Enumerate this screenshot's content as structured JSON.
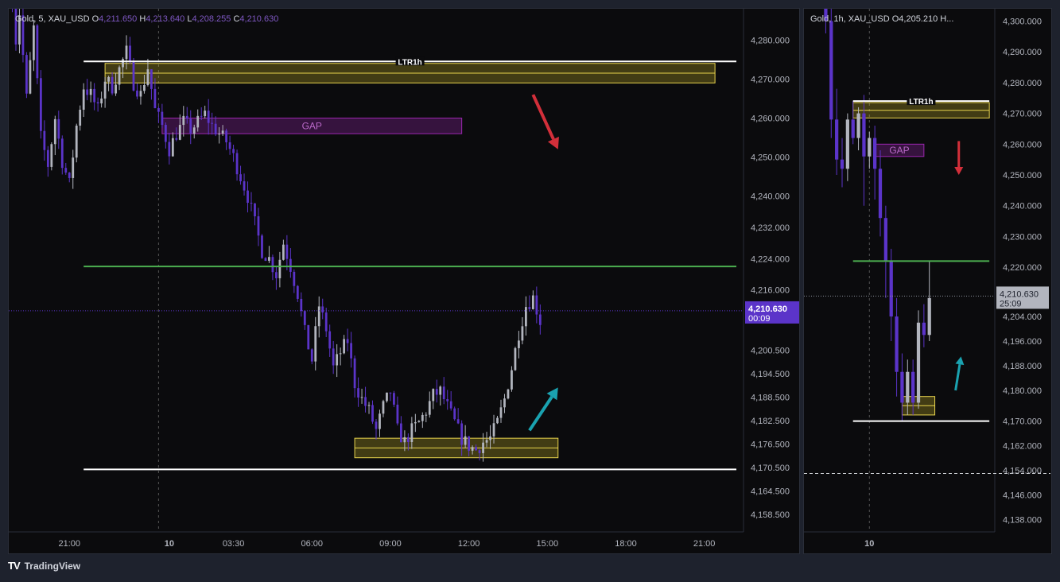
{
  "app": {
    "brand": "TradingView",
    "brand_logo": "TV"
  },
  "colors": {
    "bull": "#b2b5be",
    "bear": "#5b34c9",
    "last_price_bg": "#5b34c9",
    "green_line": "#4caf50",
    "white_line": "#ffffff",
    "zone_fill": "rgba(212,190,40,0.28)",
    "zone_stroke": "#e8d44d",
    "gap_fill": "rgba(155,39,176,0.30)",
    "gap_stroke": "#9c27b0",
    "gap_text": "#ba68c8",
    "arrow_red": "#d32f3a",
    "arrow_teal": "#1aa2b0"
  },
  "chart_data": [
    {
      "type": "candlestick",
      "legend": {
        "symbol": "Gold, 5, XAU_USD",
        "o_label": "O",
        "o_value": "4,211.650",
        "h_label": "H",
        "h_value": "4,213.640",
        "l_label": "L",
        "l_value": "4,208.255",
        "c_label": "C",
        "c_value": "4,210.630"
      },
      "y_ticks": [
        "4,280.000",
        "4,270.000",
        "4,260.000",
        "4,250.000",
        "4,240.000",
        "4,232.000",
        "4,224.000",
        "4,216.000",
        "4,200.500",
        "4,194.500",
        "4,188.500",
        "4,182.500",
        "4,176.500",
        "4,170.500",
        "4,164.500",
        "4,158.500"
      ],
      "y_tick_values": [
        4280,
        4270,
        4260,
        4250,
        4240,
        4232,
        4224,
        4216,
        4200.5,
        4194.5,
        4188.5,
        4182.5,
        4176.5,
        4170.5,
        4164.5,
        4158.5
      ],
      "x_ticks": [
        "21:00",
        "10",
        "03:30",
        "06:00",
        "09:00",
        "12:00",
        "15:00",
        "18:00",
        "21:00"
      ],
      "x_tick_bold": [
        false,
        true,
        false,
        false,
        false,
        false,
        false,
        false,
        false
      ],
      "last_price": "4,210.630",
      "last_price_value": 4210.63,
      "countdown": "00:09",
      "anchors": [
        [
          0,
          4290
        ],
        [
          1,
          4280
        ],
        [
          2,
          4287
        ],
        [
          4,
          4265
        ],
        [
          6,
          4283
        ],
        [
          8,
          4255
        ],
        [
          10,
          4248
        ],
        [
          12,
          4260
        ],
        [
          14,
          4249
        ],
        [
          16,
          4243
        ],
        [
          18,
          4258
        ],
        [
          20,
          4268
        ],
        [
          22,
          4266
        ],
        [
          24,
          4262
        ],
        [
          26,
          4270
        ],
        [
          28,
          4268
        ],
        [
          32,
          4277
        ],
        [
          34,
          4269
        ],
        [
          36,
          4266
        ],
        [
          38,
          4273
        ],
        [
          40,
          4262
        ],
        [
          42,
          4258
        ],
        [
          44,
          4252
        ],
        [
          46,
          4256
        ],
        [
          48,
          4259
        ],
        [
          50,
          4257
        ],
        [
          52,
          4259
        ],
        [
          54,
          4261
        ],
        [
          56,
          4258
        ],
        [
          58,
          4256
        ],
        [
          60,
          4254
        ],
        [
          62,
          4250
        ],
        [
          64,
          4245
        ],
        [
          66,
          4240
        ],
        [
          68,
          4233
        ],
        [
          70,
          4226
        ],
        [
          72,
          4224
        ],
        [
          74,
          4220
        ],
        [
          76,
          4228
        ],
        [
          78,
          4222
        ],
        [
          80,
          4215
        ],
        [
          82,
          4205
        ],
        [
          84,
          4198
        ],
        [
          86,
          4212
        ],
        [
          88,
          4206
        ],
        [
          90,
          4196
        ],
        [
          92,
          4200
        ],
        [
          94,
          4203
        ],
        [
          96,
          4192
        ],
        [
          98,
          4188
        ],
        [
          100,
          4185
        ],
        [
          102,
          4180
        ],
        [
          104,
          4186
        ],
        [
          106,
          4190
        ],
        [
          108,
          4180
        ],
        [
          110,
          4177
        ],
        [
          112,
          4180
        ],
        [
          114,
          4182
        ],
        [
          116,
          4185
        ],
        [
          118,
          4189
        ],
        [
          120,
          4190
        ],
        [
          122,
          4186
        ],
        [
          124,
          4182
        ],
        [
          126,
          4178
        ],
        [
          128,
          4176
        ],
        [
          130,
          4175
        ],
        [
          132,
          4177
        ],
        [
          134,
          4178
        ],
        [
          136,
          4182
        ],
        [
          138,
          4188
        ],
        [
          140,
          4196
        ],
        [
          142,
          4205
        ],
        [
          144,
          4212
        ],
        [
          146,
          4214
        ],
        [
          148,
          4208
        ]
      ],
      "candles_count": 149,
      "x_tick_index": [
        16,
        44,
        62,
        84,
        106,
        128,
        150,
        172,
        194
      ],
      "levels": [
        {
          "name": "ltr1h",
          "label": "LTR1h",
          "price": 4274.5,
          "from": 20,
          "to": 203,
          "color": "white"
        },
        {
          "name": "green",
          "price": 4222,
          "from": 20,
          "to": 203,
          "color": "green"
        },
        {
          "name": "white-low",
          "price": 4170,
          "from": 20,
          "to": 203,
          "color": "white"
        }
      ],
      "zones": [
        {
          "name": "top-zone",
          "top": 4274,
          "bottom": 4269,
          "mid": 4271.5,
          "from": 26,
          "to": 197
        },
        {
          "name": "bottom-zone",
          "top": 4178,
          "bottom": 4173,
          "mid": 4175.5,
          "from": 96,
          "to": 153
        }
      ],
      "gap": {
        "label": "GAP",
        "top": 4260,
        "bottom": 4256,
        "from": 42,
        "to": 126
      },
      "arrows": [
        {
          "name": "red-down-arrow",
          "color": "red",
          "x1": 146,
          "y1": 4266,
          "x2": 153,
          "y2": 4252
        },
        {
          "name": "teal-up-arrow",
          "color": "teal",
          "x1": 145,
          "y1": 4180,
          "x2": 153,
          "y2": 4191
        }
      ],
      "crosshair_index": 41,
      "y_range": [
        4154,
        4288
      ],
      "x_range": [
        -1,
        205
      ]
    },
    {
      "type": "candlestick",
      "legend": {
        "symbol": "Gold, 1h, XAU_USD",
        "o_label": "O",
        "o_value": "4,205.210",
        "h_label": "H...",
        "h_value": ""
      },
      "y_ticks": [
        "4,300.000",
        "4,290.000",
        "4,280.000",
        "4,270.000",
        "4,260.000",
        "4,250.000",
        "4,240.000",
        "4,230.000",
        "4,220.000",
        "4,212.000",
        "4,204.000",
        "4,196.000",
        "4,188.000",
        "4,180.000",
        "4,170.000",
        "4,162.000",
        "4,154.000",
        "4,146.000",
        "4,138.000"
      ],
      "y_tick_values": [
        4300,
        4290,
        4280,
        4270,
        4260,
        4250,
        4240,
        4230,
        4220,
        4212,
        4204,
        4196,
        4188,
        4180,
        4170,
        4162,
        4154,
        4146,
        4138
      ],
      "x_ticks": [
        "10"
      ],
      "x_tick_bold": [
        true
      ],
      "x_tick_index": [
        8
      ],
      "last_price": "4,210.630",
      "last_price_value": 4210.63,
      "countdown": "25:09",
      "candles": [
        [
          4330,
          4340,
          4296,
          4300
        ],
        [
          4300,
          4310,
          4262,
          4268
        ],
        [
          4268,
          4278,
          4250,
          4255
        ],
        [
          4255,
          4262,
          4246,
          4252
        ],
        [
          4252,
          4270,
          4248,
          4268
        ],
        [
          4268,
          4274,
          4260,
          4262
        ],
        [
          4262,
          4272,
          4258,
          4270
        ],
        [
          4270,
          4276,
          4240,
          4256
        ],
        [
          4256,
          4264,
          4252,
          4262
        ],
        [
          4262,
          4266,
          4242,
          4252
        ],
        [
          4252,
          4258,
          4230,
          4236
        ],
        [
          4236,
          4240,
          4210,
          4222
        ],
        [
          4222,
          4226,
          4196,
          4204
        ],
        [
          4204,
          4210,
          4178,
          4186
        ],
        [
          4186,
          4192,
          4170,
          4176
        ],
        [
          4176,
          4190,
          4172,
          4186
        ],
        [
          4186,
          4190,
          4172,
          4176
        ],
        [
          4176,
          4206,
          4174,
          4202
        ],
        [
          4202,
          4208,
          4194,
          4198
        ],
        [
          4198,
          4222,
          4196,
          4210
        ]
      ],
      "levels": [
        {
          "name": "ltr1h",
          "label": "LTR1h",
          "price": 4274,
          "from": 5,
          "to": 30,
          "color": "white"
        },
        {
          "name": "green",
          "price": 4222,
          "from": 5,
          "to": 30,
          "color": "green"
        },
        {
          "name": "white-low",
          "price": 4170,
          "from": 5,
          "to": 30,
          "color": "white"
        }
      ],
      "zones": [
        {
          "name": "top-zone",
          "top": 4273.5,
          "bottom": 4268.5,
          "mid": 4271,
          "from": 5,
          "to": 30
        },
        {
          "name": "bottom-zone",
          "top": 4178,
          "bottom": 4172,
          "mid": 4175,
          "from": 14,
          "to": 20
        }
      ],
      "gap": {
        "label": "GAP",
        "top": 4260,
        "bottom": 4256,
        "from": 9,
        "to": 18
      },
      "arrows": [
        {
          "name": "red-down-arrow",
          "color": "red",
          "x1": 24.4,
          "y1": 4261,
          "x2": 24.4,
          "y2": 4250
        },
        {
          "name": "teal-up-arrow",
          "color": "teal",
          "x1": 23.8,
          "y1": 4180,
          "x2": 24.8,
          "y2": 4191
        }
      ],
      "dashed_level": 4153,
      "crosshair_index": 8,
      "y_range": [
        4134,
        4304
      ],
      "x_range": [
        -4,
        31
      ]
    }
  ]
}
